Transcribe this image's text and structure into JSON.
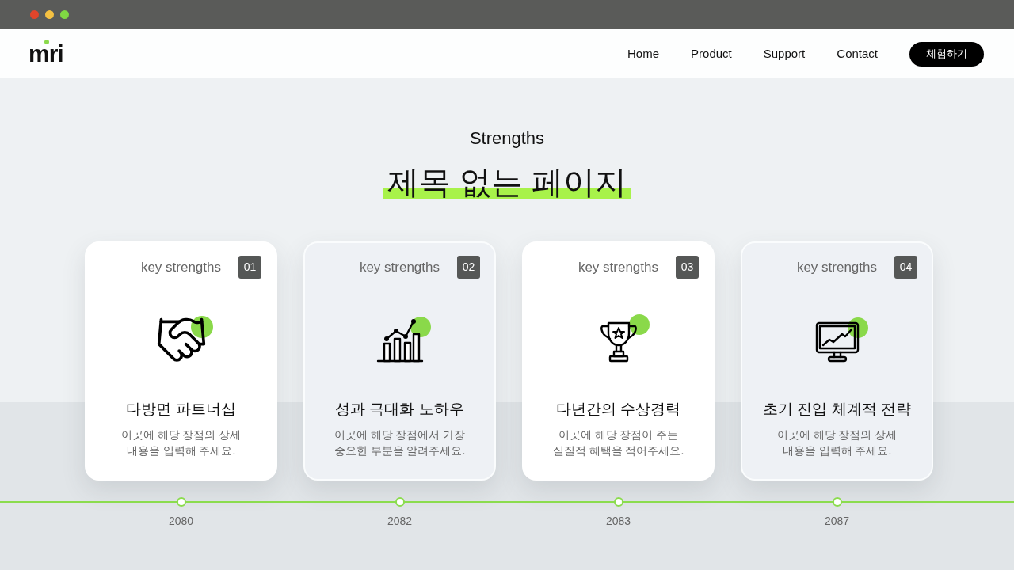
{
  "window": {
    "controls": [
      {
        "color": "#e0452b"
      },
      {
        "color": "#f5c142"
      },
      {
        "color": "#80d843"
      }
    ]
  },
  "header": {
    "logo": "mri",
    "nav": [
      {
        "label": "Home"
      },
      {
        "label": "Product"
      },
      {
        "label": "Support"
      },
      {
        "label": "Contact"
      }
    ],
    "cta": "체험하기"
  },
  "section": {
    "eyebrow": "Strengths",
    "title": "제목 없는 페이지"
  },
  "cards": [
    {
      "kind": "solid",
      "tag": "key strengths",
      "number": "01",
      "title": "다방면 파트너십",
      "description": [
        "이곳에 해당 장점의 상세",
        "내용을 입력해 주세요."
      ]
    },
    {
      "kind": "glass",
      "tag": "key strengths",
      "number": "02",
      "title": "성과 극대화 노하우",
      "description": [
        "이곳에 해당 장점에서 가장",
        "중요한 부분을 알려주세요."
      ]
    },
    {
      "kind": "solid",
      "tag": "key strengths",
      "number": "03",
      "title": "다년간의 수상경력",
      "description": [
        "이곳에 해당 장점이 주는",
        "실질적 혜택을 적어주세요."
      ]
    },
    {
      "kind": "glass",
      "tag": "key strengths",
      "number": "04",
      "title": "초기 진입 체계적 전략",
      "description": [
        "이곳에 해당 장점의 상세",
        "내용을 입력해 주세요."
      ]
    }
  ],
  "timeline": [
    {
      "year": "2080"
    },
    {
      "year": "2082"
    },
    {
      "year": "2083"
    },
    {
      "year": "2087"
    }
  ]
}
